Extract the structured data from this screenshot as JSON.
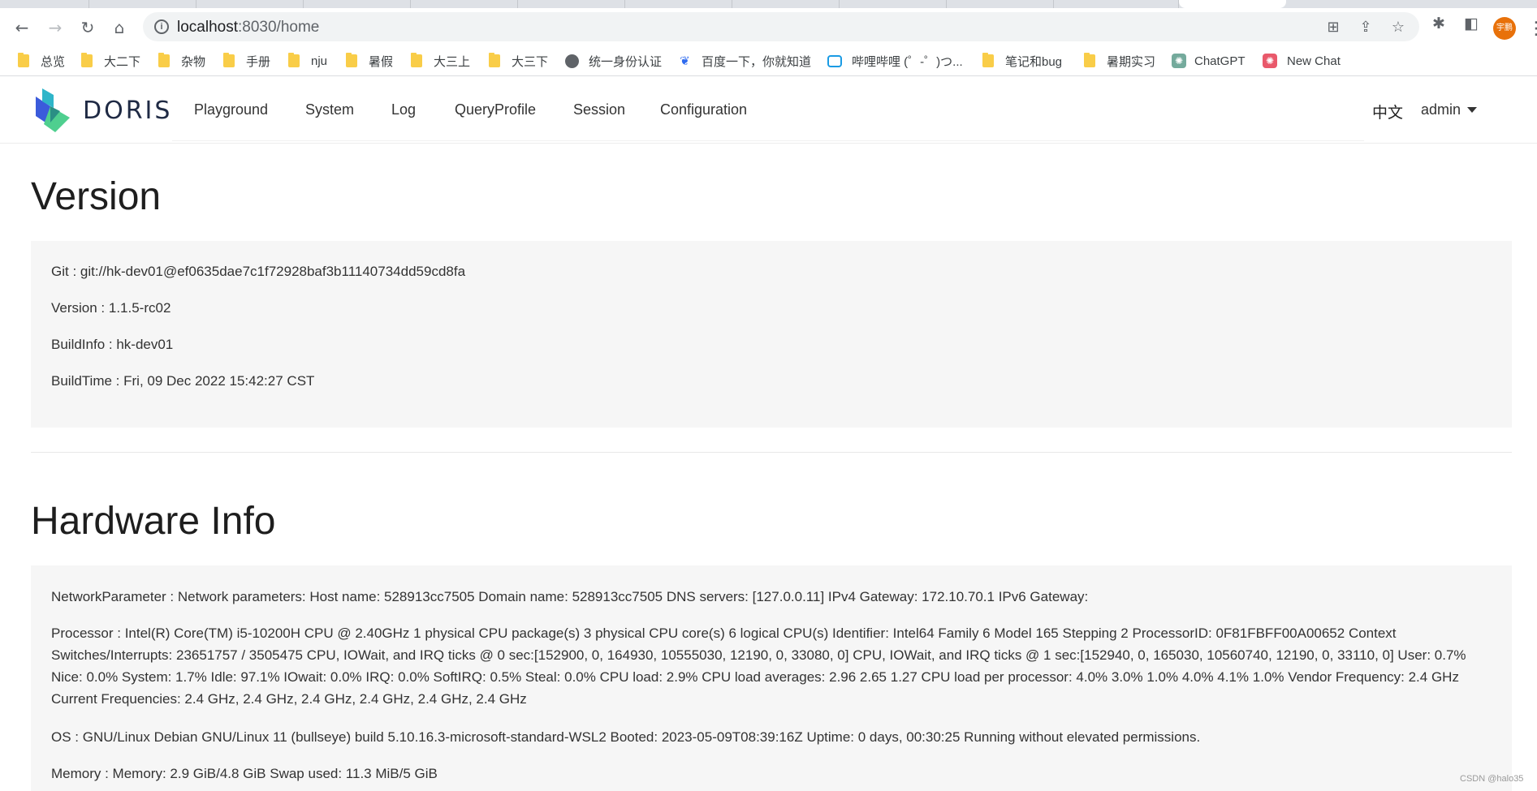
{
  "browser": {
    "url_host": "localhost",
    "url_rest": ":8030/home",
    "profile_initials": "宇鹏"
  },
  "bookmarks": [
    {
      "label": "总览",
      "icon": "folder-icon"
    },
    {
      "label": "大二下",
      "icon": "folder-icon"
    },
    {
      "label": "杂物",
      "icon": "folder-icon"
    },
    {
      "label": "手册",
      "icon": "folder-icon"
    },
    {
      "label": "nju",
      "icon": "folder-icon"
    },
    {
      "label": "暑假",
      "icon": "folder-icon"
    },
    {
      "label": "大三上",
      "icon": "folder-icon"
    },
    {
      "label": "大三下",
      "icon": "folder-icon"
    },
    {
      "label": "统一身份认证",
      "icon": "globe-icon"
    },
    {
      "label": "百度一下，你就知道",
      "icon": "baidu-icon"
    },
    {
      "label": "哔哩哔哩 (゜-゜)つ...",
      "icon": "bilibili-icon"
    },
    {
      "label": "笔记和bug",
      "icon": "folder-icon"
    },
    {
      "label": "暑期实习",
      "icon": "folder-icon"
    },
    {
      "label": "ChatGPT",
      "icon": "chatgpt-icon"
    },
    {
      "label": "New Chat",
      "icon": "newchat-icon"
    }
  ],
  "app": {
    "logo_text": "DORIS",
    "nav": [
      "Playground",
      "System",
      "Log",
      "QueryProfile",
      "Session",
      "Configuration"
    ],
    "language": "中文",
    "user": "admin"
  },
  "version": {
    "title": "Version",
    "rows": [
      "Git : git://hk-dev01@ef0635dae7c1f72928baf3b11140734dd59cd8fa",
      "Version : 1.1.5-rc02",
      "BuildInfo : hk-dev01",
      "BuildTime : Fri, 09 Dec 2022 15:42:27 CST"
    ]
  },
  "hardware": {
    "title": "Hardware Info",
    "rows": [
      "NetworkParameter : Network parameters: Host name: 528913cc7505 Domain name: 528913cc7505 DNS servers: [127.0.0.11] IPv4 Gateway: 172.10.70.1 IPv6 Gateway:",
      "Processor : Intel(R) Core(TM) i5-10200H CPU @ 2.40GHz 1 physical CPU package(s) 3 physical CPU core(s) 6 logical CPU(s) Identifier: Intel64 Family 6 Model 165 Stepping 2 ProcessorID: 0F81FBFF00A00652 Context Switches/Interrupts: 23651757 / 3505475 CPU, IOWait, and IRQ ticks @ 0 sec:[152900, 0, 164930, 10555030, 12190, 0, 33080, 0] CPU, IOWait, and IRQ ticks @ 1 sec:[152940, 0, 165030, 10560740, 12190, 0, 33110, 0] User: 0.7% Nice: 0.0% System: 1.7% Idle: 97.1% IOwait: 0.0% IRQ: 0.0% SoftIRQ: 0.5% Steal: 0.0% CPU load: 2.9% CPU load averages: 2.96 2.65 1.27 CPU load per processor: 4.0% 3.0% 1.0% 4.0% 4.1% 1.0% Vendor Frequency: 2.4 GHz Current Frequencies: 2.4 GHz, 2.4 GHz, 2.4 GHz, 2.4 GHz, 2.4 GHz, 2.4 GHz",
      "OS : GNU/Linux Debian GNU/Linux 11 (bullseye) build 5.10.16.3-microsoft-standard-WSL2 Booted: 2023-05-09T08:39:16Z Uptime: 0 days, 00:30:25 Running without elevated permissions.",
      "Memory : Memory: 2.9 GiB/4.8 GiB Swap used: 11.3 MiB/5 GiB"
    ]
  },
  "watermark": "CSDN @halo35"
}
